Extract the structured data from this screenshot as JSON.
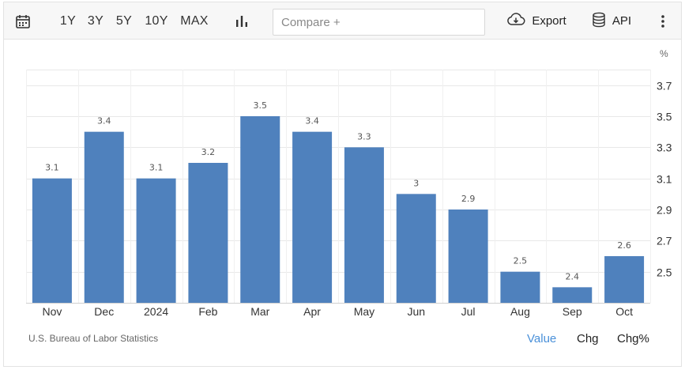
{
  "toolbar": {
    "ranges": [
      "1Y",
      "3Y",
      "5Y",
      "10Y",
      "MAX"
    ],
    "compare_placeholder": "Compare +",
    "export_label": "Export",
    "api_label": "API",
    "icons": [
      "calendar-icon",
      "bar-chart-icon",
      "cloud-download-icon",
      "database-icon",
      "more-vertical-icon"
    ]
  },
  "footer": {
    "source": "U.S. Bureau of Labor Statistics",
    "tabs": [
      "Value",
      "Chg",
      "Chg%"
    ],
    "active_tab": "Value"
  },
  "colors": {
    "bar": "#4f81bd",
    "active_tab": "#4a90d9"
  },
  "chart_data": {
    "type": "bar",
    "categories": [
      "Nov",
      "Dec",
      "2024",
      "Feb",
      "Mar",
      "Apr",
      "May",
      "Jun",
      "Jul",
      "Aug",
      "Sep",
      "Oct"
    ],
    "values": [
      3.1,
      3.4,
      3.1,
      3.2,
      3.5,
      3.4,
      3.3,
      3,
      2.9,
      2.5,
      2.4,
      2.6
    ],
    "data_labels": [
      "3.1",
      "3.4",
      "3.1",
      "3.2",
      "3.5",
      "3.4",
      "3.3",
      "3",
      "2.9",
      "2.5",
      "2.4",
      "2.6"
    ],
    "unit": "%",
    "ylim": [
      2.3,
      3.8
    ],
    "yticks": [
      "3.7",
      "3.5",
      "3.3",
      "3.1",
      "2.9",
      "2.7",
      "2.5"
    ],
    "ytick_values": [
      3.7,
      3.5,
      3.3,
      3.1,
      2.9,
      2.7,
      2.5
    ],
    "yaxis_position": "right",
    "grid": true
  }
}
